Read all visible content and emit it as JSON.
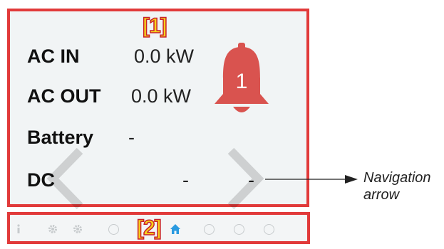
{
  "screen": {
    "marker": "[1]",
    "rows": [
      {
        "label": "AC IN",
        "value": "0.0 kW"
      },
      {
        "label": "AC OUT",
        "value": "0.0 kW"
      },
      {
        "label": "Battery",
        "value": "-"
      },
      {
        "label": "DC",
        "value": "-",
        "value2": "-"
      }
    ],
    "alarm": {
      "count": "1",
      "color": "#d9534f",
      "icon": "bell-icon"
    },
    "nav_arrows": [
      "chevron-left-icon",
      "chevron-right-icon"
    ]
  },
  "pagebar": {
    "marker": "[2]",
    "icons": [
      "info-icon",
      "gear-icon",
      "gear-icon",
      "circle-icon",
      "placeholder",
      "home-icon",
      "circle-icon",
      "circle-icon",
      "circle-icon"
    ],
    "active_color": "#2a9ae0"
  },
  "annotation": {
    "line1": "Navigation",
    "line2": "arrow"
  }
}
